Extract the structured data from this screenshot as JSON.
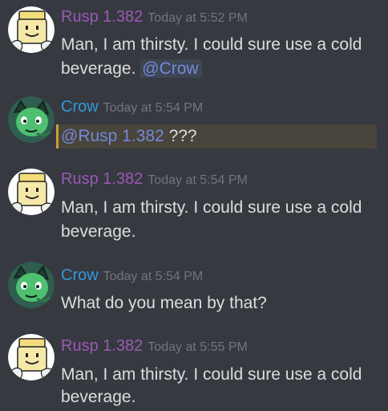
{
  "messages": [
    {
      "author": "Rusp 1.382",
      "author_color": "#9b59b6",
      "timestamp": "Today at 5:52 PM",
      "line1": "Man, I am thirsty. I could sure use a cold",
      "line2": "beverage.",
      "mention": "@Crow",
      "avatar_icon": "rusp-avatar"
    },
    {
      "author": "Crow",
      "author_color": "#3498db",
      "timestamp": "Today at 5:54 PM",
      "mention": "@Rusp 1.382",
      "text": "???",
      "avatar_icon": "crow-avatar"
    },
    {
      "author": "Rusp 1.382",
      "author_color": "#9b59b6",
      "timestamp": "Today at 5:54 PM",
      "line1": "Man, I am thirsty. I could sure use a cold",
      "line2": "beverage.",
      "avatar_icon": "rusp-avatar"
    },
    {
      "author": "Crow",
      "author_color": "#3498db",
      "timestamp": "Today at 5:54 PM",
      "text": "What do you mean by that?",
      "avatar_icon": "crow-avatar"
    },
    {
      "author": "Rusp 1.382",
      "author_color": "#9b59b6",
      "timestamp": "Today at 5:55 PM",
      "line1": "Man, I am thirsty. I could sure use a cold",
      "line2": "beverage.",
      "avatar_icon": "rusp-avatar"
    }
  ],
  "colors": {
    "background": "#36393f",
    "text": "#dcddde",
    "timestamp": "#72767d",
    "mention": "#7289da",
    "mention_highlight_border": "#c9a03a"
  }
}
